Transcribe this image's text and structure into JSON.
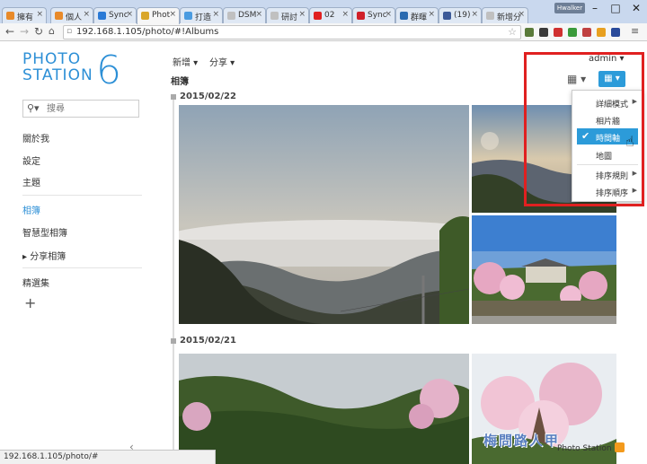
{
  "browser": {
    "tabs": [
      {
        "label": "擁有",
        "color": "#e88a2a"
      },
      {
        "label": "個人",
        "color": "#e88a2a"
      },
      {
        "label": "Sync",
        "color": "#2a7ad6"
      },
      {
        "label": "Phot",
        "color": "#d9a62a"
      },
      {
        "label": "打造",
        "color": "#4a9be0"
      },
      {
        "label": "DSM",
        "color": "#c0c0c0"
      },
      {
        "label": "研討",
        "color": "#c0c0c0"
      },
      {
        "label": "02",
        "color": "#e02020"
      },
      {
        "label": "Sync",
        "color": "#d0202a"
      },
      {
        "label": "群暉",
        "color": "#2a6ab0"
      },
      {
        "label": "(19)",
        "color": "#3b5998"
      },
      {
        "label": "新增分",
        "color": "#c0c0c0"
      }
    ],
    "user_badge": "Hwalker",
    "url": "192.168.1.105/photo/#!Albums",
    "status_url": "192.168.1.105/photo/#"
  },
  "sidebar": {
    "logo_line1": "PHOTO",
    "logo_line2": "STATION",
    "logo_number": "6",
    "search_placeholder": "搜尋",
    "items": [
      {
        "label": "關於我"
      },
      {
        "label": "設定"
      },
      {
        "label": "主題"
      },
      {
        "label": "相簿"
      },
      {
        "label": "智慧型相簿"
      },
      {
        "label": "▸ 分享相簿"
      },
      {
        "label": "精選集"
      }
    ],
    "add_symbol": "+",
    "collapse_symbol": "‹"
  },
  "main": {
    "menu_new": "新增 ▾",
    "menu_share": "分享 ▾",
    "admin": "admin ▾",
    "breadcrumb": "相簿",
    "sections": [
      {
        "date": "2015/02/22"
      },
      {
        "date": "2015/02/21"
      }
    ]
  },
  "dropdown": {
    "items": [
      {
        "label": "詳細模式",
        "arrow": "▶"
      },
      {
        "label": "相片牆",
        "arrow": ""
      },
      {
        "label": "時間軸",
        "arrow": ""
      },
      {
        "label": "地圖",
        "arrow": ""
      },
      {
        "label": "排序規則",
        "arrow": "▶"
      },
      {
        "label": "排序順序",
        "arrow": "▶"
      }
    ],
    "selected_index": 2
  },
  "footer": {
    "text": "Photo Station 6",
    "watermark": "梅問路人甲"
  },
  "colors": {
    "accent": "#2c9bd9",
    "highlight_box": "#e02020"
  }
}
